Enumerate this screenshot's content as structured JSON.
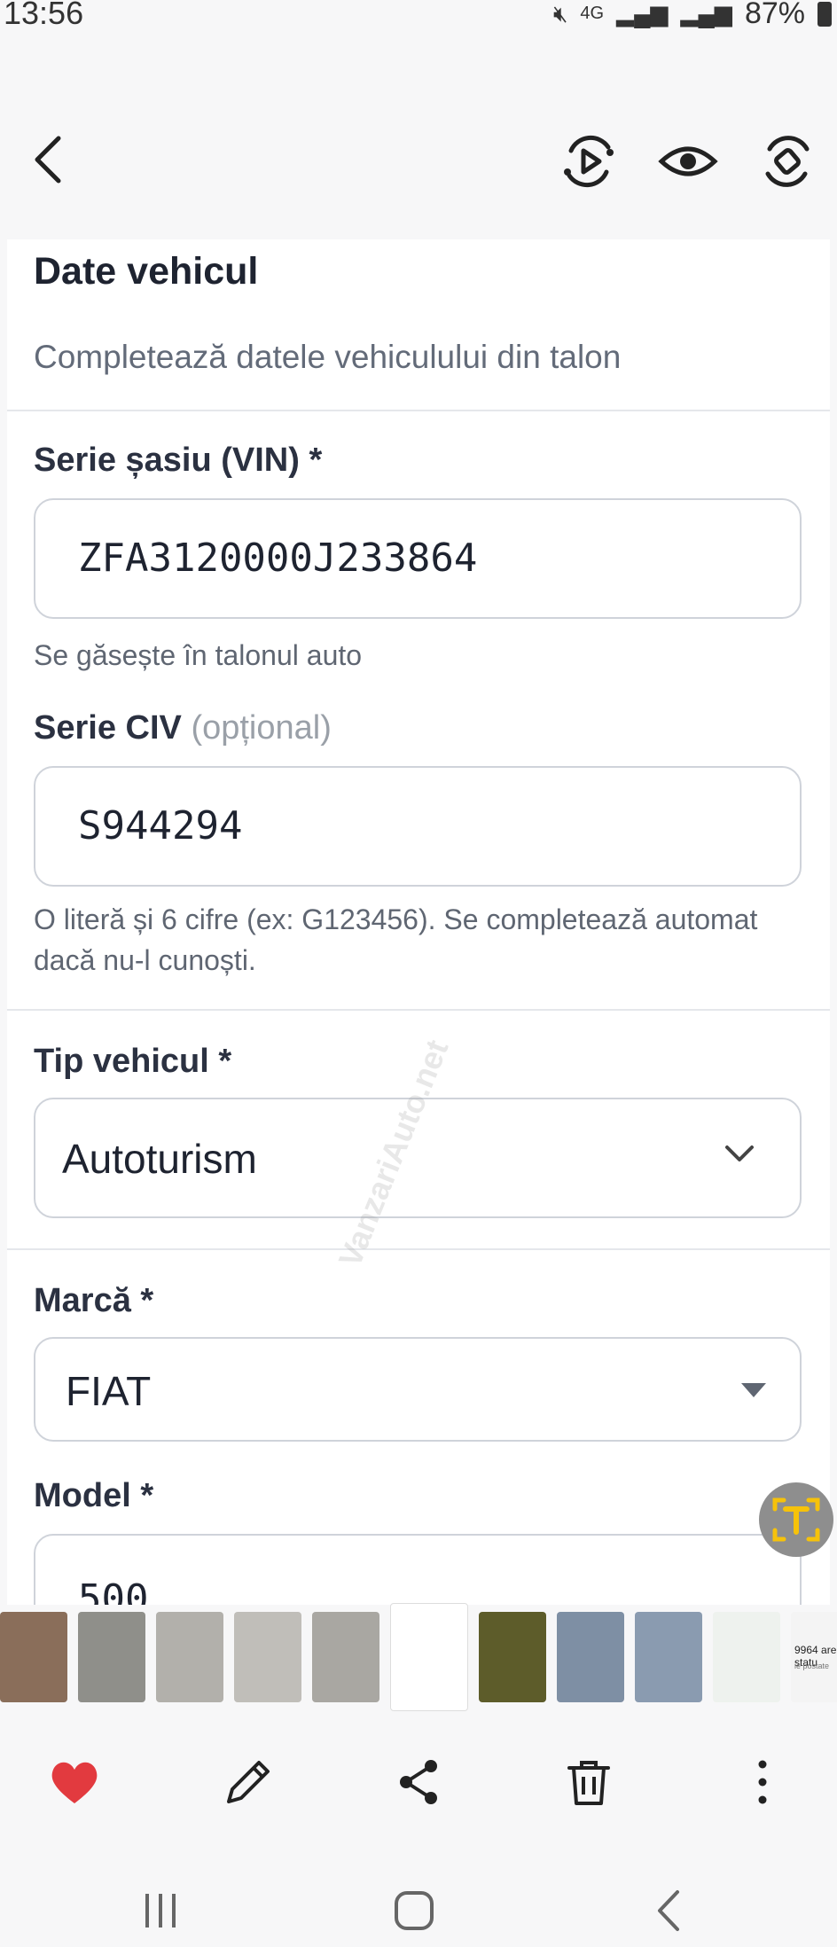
{
  "status_bar": {
    "time": "13:56",
    "network": "4G",
    "battery": "87%"
  },
  "form": {
    "section_title": "Date vehicul",
    "section_subtitle": "Completează datele vehiculului din talon",
    "vin": {
      "label": "Serie șasiu (VIN) *",
      "value": "ZFA3120000J233864",
      "hint": "Se găsește în talonul auto"
    },
    "civ": {
      "label": "Serie CIV",
      "optional_tag": "(opțional)",
      "value": "S944294",
      "hint": "O literă și 6 cifre (ex: G123456). Se completează automat dacă nu-l cunoști."
    },
    "vehicle_type": {
      "label": "Tip vehicul *",
      "selected": "Autoturism"
    },
    "brand": {
      "label": "Marcă *",
      "selected": "FIAT"
    },
    "model": {
      "label": "Model *",
      "value": "500"
    }
  },
  "watermark": "VanzariAuto.net",
  "thumbnails": [
    {
      "kind": "photo",
      "color": "#8a6e5a"
    },
    {
      "kind": "document",
      "color": "#8f8f8a"
    },
    {
      "kind": "document",
      "color": "#b2b0ab"
    },
    {
      "kind": "document",
      "color": "#c0beb9"
    },
    {
      "kind": "document",
      "color": "#a9a7a2"
    },
    {
      "kind": "screenshot-active",
      "color": "#ffffff"
    },
    {
      "kind": "photo",
      "color": "#5d5c2a"
    },
    {
      "kind": "photo",
      "color": "#7e8fa4"
    },
    {
      "kind": "photo",
      "color": "#8a9bb0"
    },
    {
      "kind": "screenshot",
      "color": "#eef2ee"
    },
    {
      "kind": "screenshot",
      "color": "#f4f4f4",
      "text": "9964 are statu",
      "subtext": "ie postate"
    }
  ],
  "colors": {
    "heart": "#e23a3f",
    "text": "#1e2330",
    "muted": "#636b79",
    "ocr_accent": "#f6c20a"
  }
}
